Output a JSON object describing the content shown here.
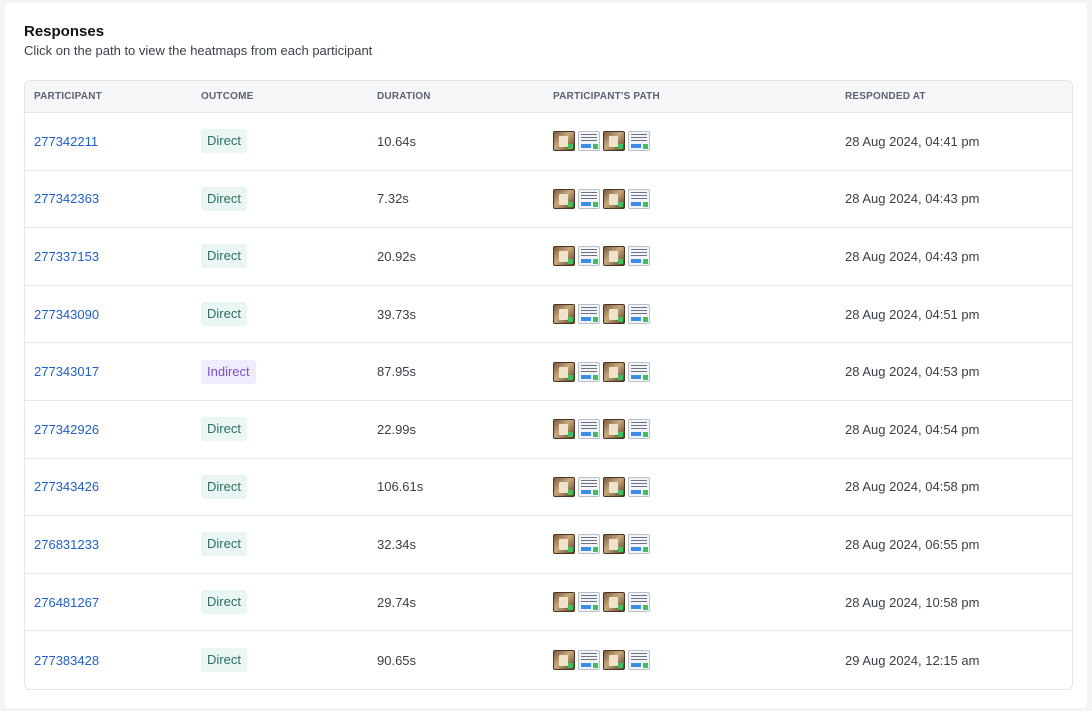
{
  "header": {
    "title": "Responses",
    "subtitle": "Click on the path to view the heatmaps from each participant"
  },
  "columns": {
    "participant": "PARTICIPANT",
    "outcome": "OUTCOME",
    "duration": "DURATION",
    "path": "PARTICIPANT'S PATH",
    "responded_at": "RESPONDED AT"
  },
  "colors": {
    "link": "#1f5fc9",
    "direct_bg": "#e9f6f3",
    "direct_text": "#2f6f61",
    "indirect_bg": "#f1ecfc",
    "indirect_text": "#7a52d6"
  },
  "rows": [
    {
      "participant": "277342211",
      "outcome": "Direct",
      "duration": "10.64s",
      "responded_at": "28 Aug 2024, 04:41 pm"
    },
    {
      "participant": "277342363",
      "outcome": "Direct",
      "duration": "7.32s",
      "responded_at": "28 Aug 2024, 04:43 pm"
    },
    {
      "participant": "277337153",
      "outcome": "Direct",
      "duration": "20.92s",
      "responded_at": "28 Aug 2024, 04:43 pm"
    },
    {
      "participant": "277343090",
      "outcome": "Direct",
      "duration": "39.73s",
      "responded_at": "28 Aug 2024, 04:51 pm"
    },
    {
      "participant": "277343017",
      "outcome": "Indirect",
      "duration": "87.95s",
      "responded_at": "28 Aug 2024, 04:53 pm"
    },
    {
      "participant": "277342926",
      "outcome": "Direct",
      "duration": "22.99s",
      "responded_at": "28 Aug 2024, 04:54 pm"
    },
    {
      "participant": "277343426",
      "outcome": "Direct",
      "duration": "106.61s",
      "responded_at": "28 Aug 2024, 04:58 pm"
    },
    {
      "participant": "276831233",
      "outcome": "Direct",
      "duration": "32.34s",
      "responded_at": "28 Aug 2024, 06:55 pm"
    },
    {
      "participant": "276481267",
      "outcome": "Direct",
      "duration": "29.74s",
      "responded_at": "28 Aug 2024, 10:58 pm"
    },
    {
      "participant": "277383428",
      "outcome": "Direct",
      "duration": "90.65s",
      "responded_at": "29 Aug 2024, 12:15 am"
    }
  ]
}
